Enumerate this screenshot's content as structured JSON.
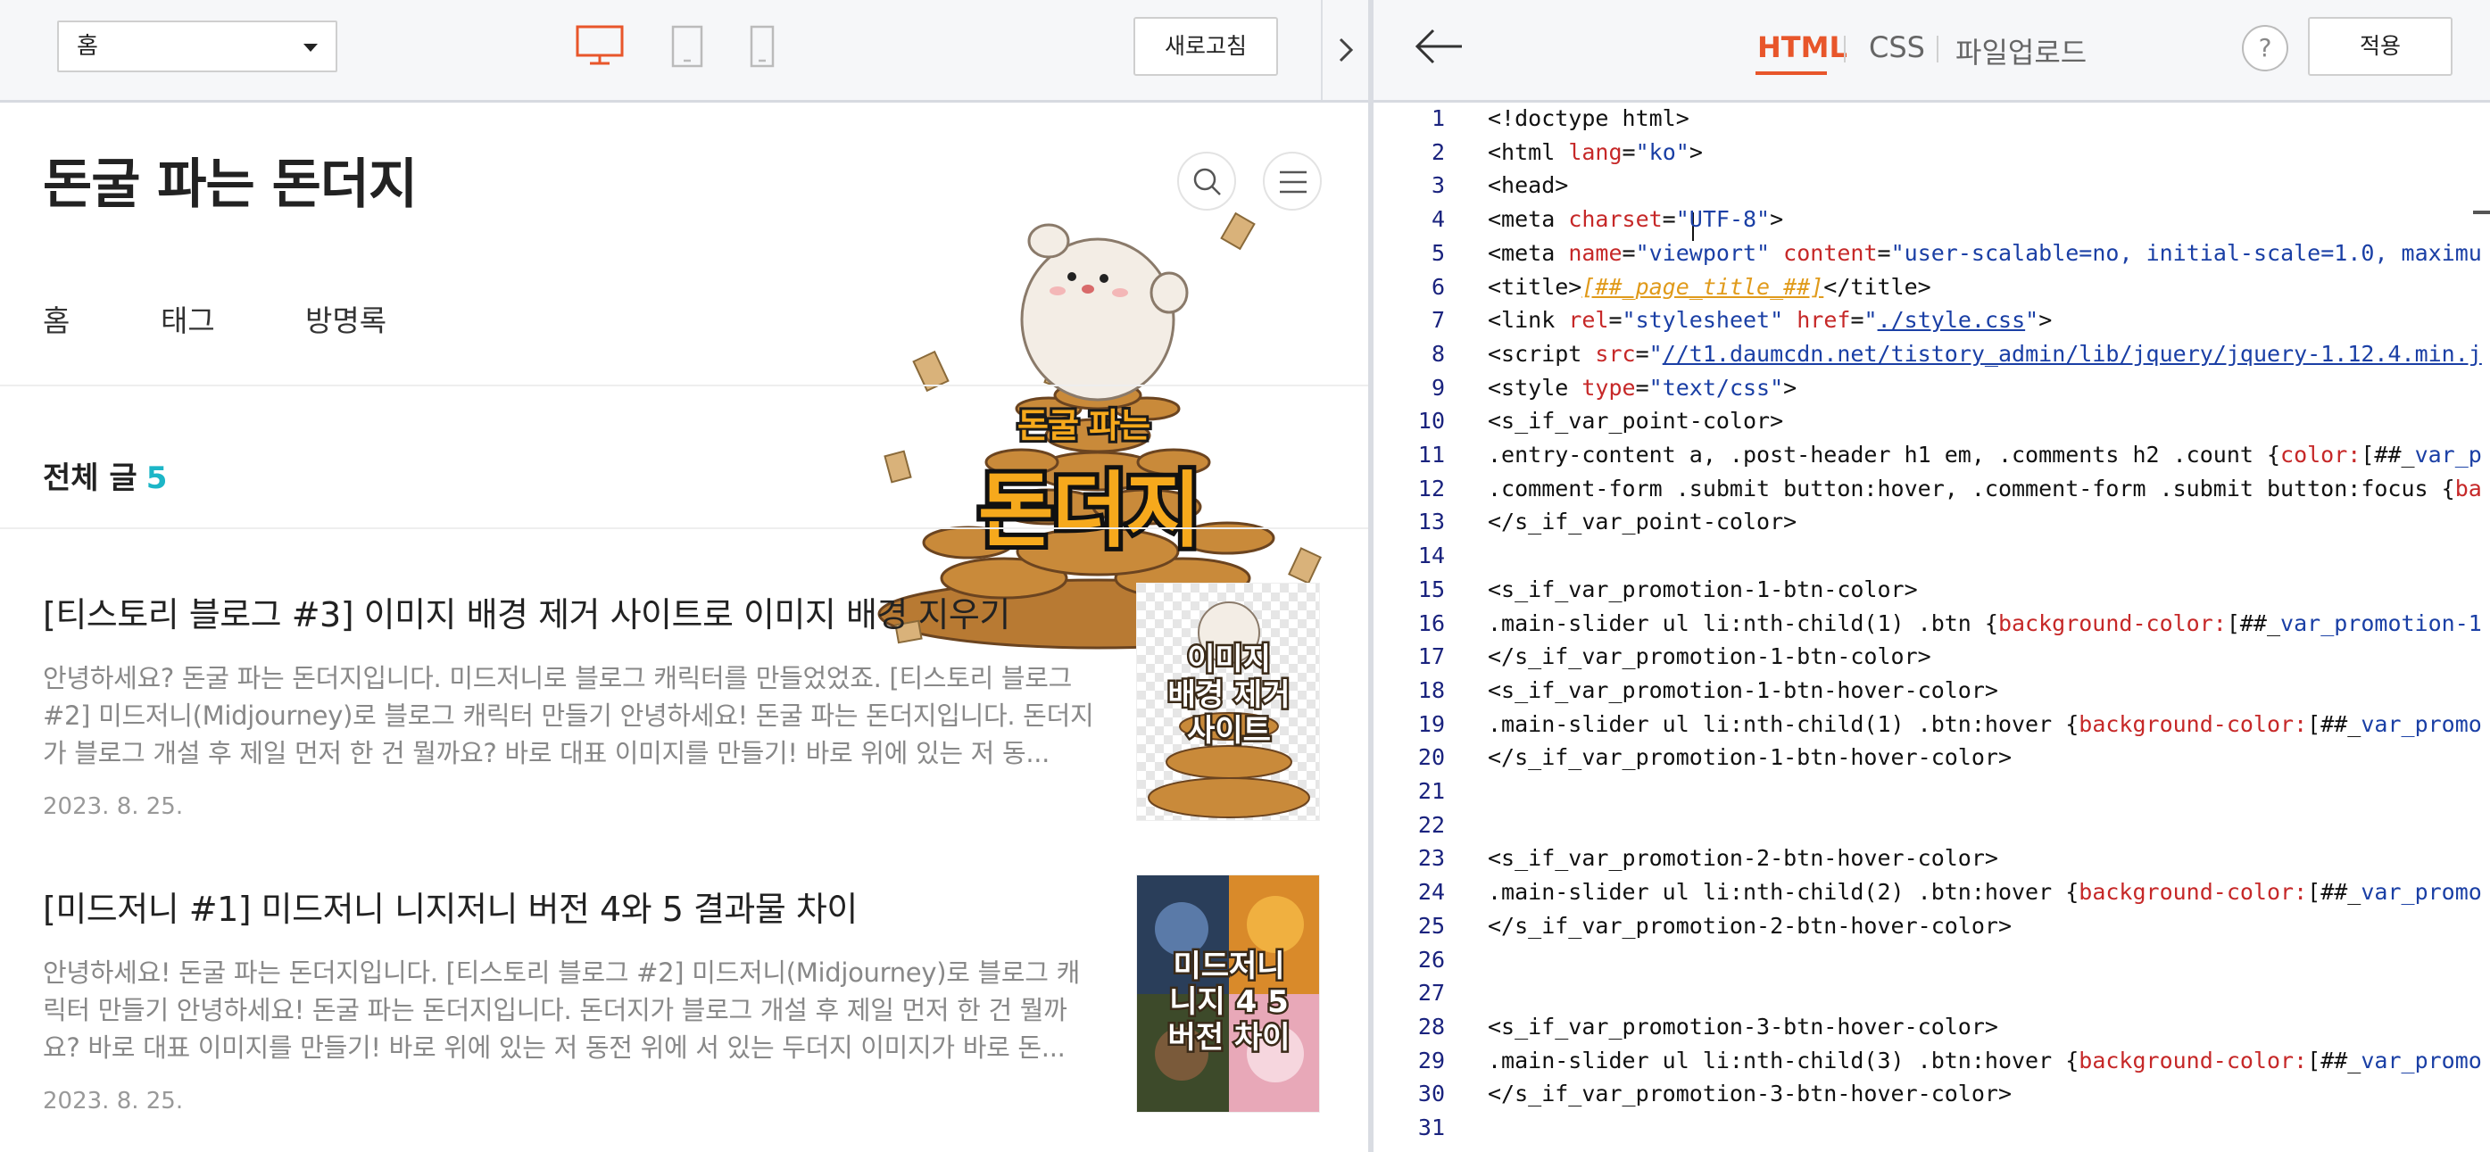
{
  "preview_toolbar": {
    "page_select_value": "홈",
    "refresh_label": "새로고침"
  },
  "blog": {
    "title": "돈굴 파는 돈더지",
    "nav": [
      "홈",
      "태그",
      "방명록"
    ],
    "total_label": "전체 글",
    "total_count": "5",
    "mascot_text_small": "돈굴 파는",
    "mascot_text_big": "돈더지",
    "posts": [
      {
        "title": "[티스토리 블로그 #3] 이미지 배경 제거 사이트로 이미지 배경 지우기",
        "excerpt": "안녕하세요? 돈굴 파는 돈더지입니다. 미드저니로 블로그 캐릭터를 만들었었죠. [티스토리 블로그 #2] 미드저니(Midjourney)로 블로그 캐릭터 만들기 안녕하세요! 돈굴 파는 돈더지입니다. 돈더지가 블로그 개설 후 제일 먼저 한 건 뭘까요? 바로 대표 이미지를 만들기! 바로 위에 있는 저 동...",
        "date": "2023. 8. 25.",
        "thumb_lines": [
          "이미지",
          "배경 제거",
          "사이트"
        ]
      },
      {
        "title": "[미드저니 #1] 미드저니 니지저니 버전 4와 5 결과물 차이",
        "excerpt": "안녕하세요! 돈굴 파는 돈더지입니다. [티스토리 블로그 #2] 미드저니(Midjourney)로 블로그 캐릭터 만들기 안녕하세요! 돈굴 파는 돈더지입니다. 돈더지가 블로그 개설 후 제일 먼저 한 건 뭘까요? 바로 대표 이미지를 만들기! 바로 위에 있는 저 동전 위에 서 있는 두더지 이미지가 바로 돈...",
        "date": "2023. 8. 25.",
        "thumb_lines": [
          "미드저니",
          "니지 4 5",
          "버전 차이"
        ]
      }
    ]
  },
  "editor_toolbar": {
    "tabs": [
      "HTML",
      "CSS",
      "파일업로드"
    ],
    "active_tab": "HTML",
    "help_label": "?",
    "apply_label": "적용"
  },
  "editor": {
    "line_numbers": [
      "1",
      "2",
      "3",
      "4",
      "5",
      "6",
      "7",
      "8",
      "9",
      "10",
      "11",
      "12",
      "13",
      "14",
      "15",
      "16",
      "17",
      "18",
      "19",
      "20",
      "21",
      "22",
      "23",
      "24",
      "25",
      "26",
      "27",
      "28",
      "29",
      "30",
      "31"
    ],
    "lines": {
      "l1": "<!doctype html>",
      "l2a": "<html ",
      "l2b": "lang",
      "l2c": "=",
      "l2d": "\"ko\"",
      "l2e": ">",
      "l3": "<head>",
      "l4a": "<meta ",
      "l4b": "charset",
      "l4c": "=",
      "l4d": "\"UTF-8\"",
      "l4e": ">",
      "l5a": "<meta ",
      "l5b": "name",
      "l5c": "=",
      "l5d": "\"viewport\"",
      "l5e": " ",
      "l5f": "content",
      "l5g": "=",
      "l5h": "\"user-scalable=no, initial-scale=1.0, maximu",
      "l6a": "<title>",
      "l6b": "[##_page_title_##]",
      "l6c": "</title>",
      "l7a": "<link ",
      "l7b": "rel",
      "l7c": "=",
      "l7d": "\"stylesheet\"",
      "l7e": " ",
      "l7f": "href",
      "l7g": "=",
      "l7h": "\"",
      "l7i": "./style.css",
      "l7j": "\"",
      "l7k": ">",
      "l8a": "<script ",
      "l8b": "src",
      "l8c": "=",
      "l8d": "\"",
      "l8e": "//t1.daumcdn.net/tistory_admin/lib/jquery/jquery-1.12.4.min.j",
      "l9a": "<style ",
      "l9b": "type",
      "l9c": "=",
      "l9d": "\"text/css\"",
      "l9e": ">",
      "l10": "<s_if_var_point-color>",
      "l11a": ".entry-content a, .post-header h1 em, .comments h2 .count {",
      "l11b": "color:",
      "l11c": "[##_",
      "l11d": "var_p",
      "l12a": ".comment-form .submit button:hover, .comment-form .submit button:focus {",
      "l12b": "ba",
      "l13": "</s_if_var_point-color>",
      "l15": "<s_if_var_promotion-1-btn-color>",
      "l16a": ".main-slider ul li:nth-child(1) .btn {",
      "l16b": "background-color:",
      "l16c": "[##_",
      "l16d": "var_promotion-1",
      "l17": "</s_if_var_promotion-1-btn-color>",
      "l18": "<s_if_var_promotion-1-btn-hover-color>",
      "l19a": ".main-slider ul li:nth-child(1) .btn:hover {",
      "l19b": "background-color:",
      "l19c": "[##_",
      "l19d": "var_promo",
      "l20": "</s_if_var_promotion-1-btn-hover-color>",
      "l23": "<s_if_var_promotion-2-btn-hover-color>",
      "l24a": ".main-slider ul li:nth-child(2) .btn:hover {",
      "l24b": "background-color:",
      "l24c": "[##_",
      "l24d": "var_promo",
      "l25": "</s_if_var_promotion-2-btn-hover-color>",
      "l28": "<s_if_var_promotion-3-btn-hover-color>",
      "l29a": ".main-slider ul li:nth-child(3) .btn:hover {",
      "l29b": "background-color:",
      "l29c": "[##_",
      "l29d": "var_promo",
      "l30": "</s_if_var_promotion-3-btn-hover-color>"
    }
  },
  "colors": {
    "accent": "#e8562b",
    "count": "#1cb6c7",
    "line_number": "#1a237e",
    "attr": "#c62828",
    "string": "#1a3fa5",
    "template": "#e09a1a"
  },
  "icons": [
    "desktop-icon",
    "tablet-icon",
    "mobile-icon",
    "chevron-right-icon",
    "search-icon",
    "hamburger-icon",
    "arrow-left-icon",
    "help-icon"
  ]
}
